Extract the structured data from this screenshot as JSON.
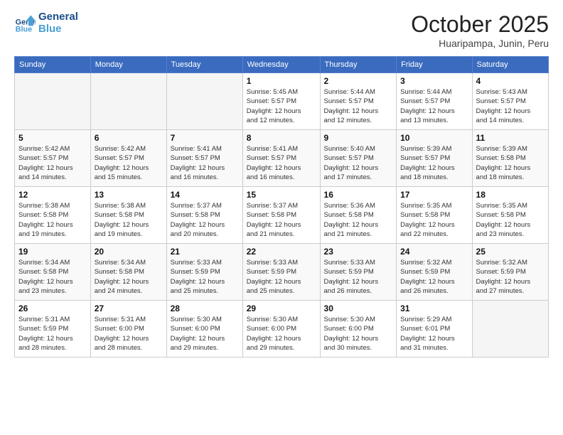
{
  "header": {
    "logo_line1": "General",
    "logo_line2": "Blue",
    "month": "October 2025",
    "location": "Huaripampa, Junin, Peru"
  },
  "weekdays": [
    "Sunday",
    "Monday",
    "Tuesday",
    "Wednesday",
    "Thursday",
    "Friday",
    "Saturday"
  ],
  "weeks": [
    [
      {
        "day": "",
        "info": ""
      },
      {
        "day": "",
        "info": ""
      },
      {
        "day": "",
        "info": ""
      },
      {
        "day": "1",
        "info": "Sunrise: 5:45 AM\nSunset: 5:57 PM\nDaylight: 12 hours\nand 12 minutes."
      },
      {
        "day": "2",
        "info": "Sunrise: 5:44 AM\nSunset: 5:57 PM\nDaylight: 12 hours\nand 12 minutes."
      },
      {
        "day": "3",
        "info": "Sunrise: 5:44 AM\nSunset: 5:57 PM\nDaylight: 12 hours\nand 13 minutes."
      },
      {
        "day": "4",
        "info": "Sunrise: 5:43 AM\nSunset: 5:57 PM\nDaylight: 12 hours\nand 14 minutes."
      }
    ],
    [
      {
        "day": "5",
        "info": "Sunrise: 5:42 AM\nSunset: 5:57 PM\nDaylight: 12 hours\nand 14 minutes."
      },
      {
        "day": "6",
        "info": "Sunrise: 5:42 AM\nSunset: 5:57 PM\nDaylight: 12 hours\nand 15 minutes."
      },
      {
        "day": "7",
        "info": "Sunrise: 5:41 AM\nSunset: 5:57 PM\nDaylight: 12 hours\nand 16 minutes."
      },
      {
        "day": "8",
        "info": "Sunrise: 5:41 AM\nSunset: 5:57 PM\nDaylight: 12 hours\nand 16 minutes."
      },
      {
        "day": "9",
        "info": "Sunrise: 5:40 AM\nSunset: 5:57 PM\nDaylight: 12 hours\nand 17 minutes."
      },
      {
        "day": "10",
        "info": "Sunrise: 5:39 AM\nSunset: 5:57 PM\nDaylight: 12 hours\nand 18 minutes."
      },
      {
        "day": "11",
        "info": "Sunrise: 5:39 AM\nSunset: 5:58 PM\nDaylight: 12 hours\nand 18 minutes."
      }
    ],
    [
      {
        "day": "12",
        "info": "Sunrise: 5:38 AM\nSunset: 5:58 PM\nDaylight: 12 hours\nand 19 minutes."
      },
      {
        "day": "13",
        "info": "Sunrise: 5:38 AM\nSunset: 5:58 PM\nDaylight: 12 hours\nand 19 minutes."
      },
      {
        "day": "14",
        "info": "Sunrise: 5:37 AM\nSunset: 5:58 PM\nDaylight: 12 hours\nand 20 minutes."
      },
      {
        "day": "15",
        "info": "Sunrise: 5:37 AM\nSunset: 5:58 PM\nDaylight: 12 hours\nand 21 minutes."
      },
      {
        "day": "16",
        "info": "Sunrise: 5:36 AM\nSunset: 5:58 PM\nDaylight: 12 hours\nand 21 minutes."
      },
      {
        "day": "17",
        "info": "Sunrise: 5:35 AM\nSunset: 5:58 PM\nDaylight: 12 hours\nand 22 minutes."
      },
      {
        "day": "18",
        "info": "Sunrise: 5:35 AM\nSunset: 5:58 PM\nDaylight: 12 hours\nand 23 minutes."
      }
    ],
    [
      {
        "day": "19",
        "info": "Sunrise: 5:34 AM\nSunset: 5:58 PM\nDaylight: 12 hours\nand 23 minutes."
      },
      {
        "day": "20",
        "info": "Sunrise: 5:34 AM\nSunset: 5:58 PM\nDaylight: 12 hours\nand 24 minutes."
      },
      {
        "day": "21",
        "info": "Sunrise: 5:33 AM\nSunset: 5:59 PM\nDaylight: 12 hours\nand 25 minutes."
      },
      {
        "day": "22",
        "info": "Sunrise: 5:33 AM\nSunset: 5:59 PM\nDaylight: 12 hours\nand 25 minutes."
      },
      {
        "day": "23",
        "info": "Sunrise: 5:33 AM\nSunset: 5:59 PM\nDaylight: 12 hours\nand 26 minutes."
      },
      {
        "day": "24",
        "info": "Sunrise: 5:32 AM\nSunset: 5:59 PM\nDaylight: 12 hours\nand 26 minutes."
      },
      {
        "day": "25",
        "info": "Sunrise: 5:32 AM\nSunset: 5:59 PM\nDaylight: 12 hours\nand 27 minutes."
      }
    ],
    [
      {
        "day": "26",
        "info": "Sunrise: 5:31 AM\nSunset: 5:59 PM\nDaylight: 12 hours\nand 28 minutes."
      },
      {
        "day": "27",
        "info": "Sunrise: 5:31 AM\nSunset: 6:00 PM\nDaylight: 12 hours\nand 28 minutes."
      },
      {
        "day": "28",
        "info": "Sunrise: 5:30 AM\nSunset: 6:00 PM\nDaylight: 12 hours\nand 29 minutes."
      },
      {
        "day": "29",
        "info": "Sunrise: 5:30 AM\nSunset: 6:00 PM\nDaylight: 12 hours\nand 29 minutes."
      },
      {
        "day": "30",
        "info": "Sunrise: 5:30 AM\nSunset: 6:00 PM\nDaylight: 12 hours\nand 30 minutes."
      },
      {
        "day": "31",
        "info": "Sunrise: 5:29 AM\nSunset: 6:01 PM\nDaylight: 12 hours\nand 31 minutes."
      },
      {
        "day": "",
        "info": ""
      }
    ]
  ]
}
